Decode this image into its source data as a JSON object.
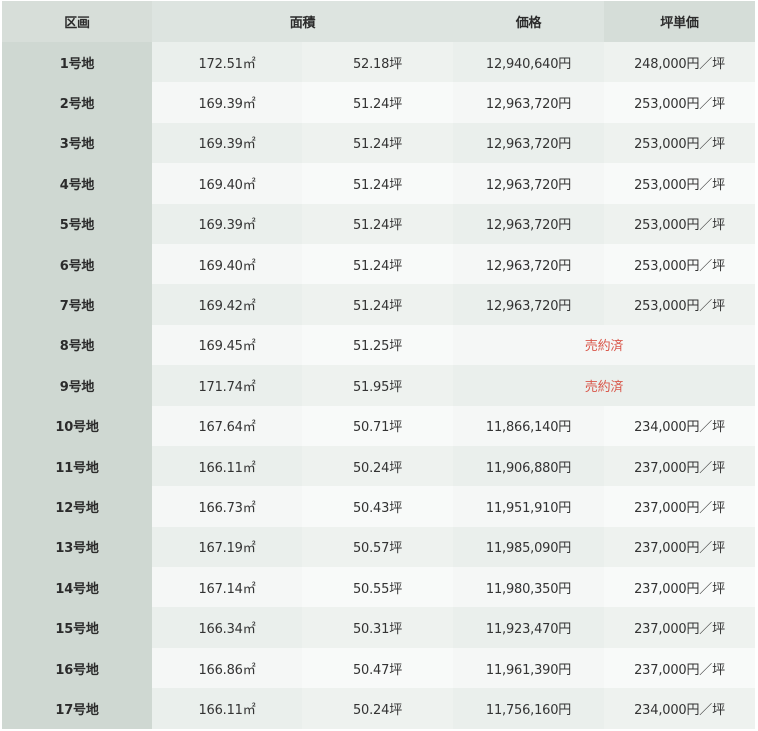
{
  "header": {
    "section": "区画",
    "area": "面積",
    "price": "価格",
    "unit_price": "坪単価"
  },
  "sold_label": "売約済",
  "rows": [
    {
      "section": "1号地",
      "m2": "172.51㎡",
      "tsubo": "52.18坪",
      "price": "12,940,640円",
      "unit": "248,000円／坪",
      "sold": false
    },
    {
      "section": "2号地",
      "m2": "169.39㎡",
      "tsubo": "51.24坪",
      "price": "12,963,720円",
      "unit": "253,000円／坪",
      "sold": false
    },
    {
      "section": "3号地",
      "m2": "169.39㎡",
      "tsubo": "51.24坪",
      "price": "12,963,720円",
      "unit": "253,000円／坪",
      "sold": false
    },
    {
      "section": "4号地",
      "m2": "169.40㎡",
      "tsubo": "51.24坪",
      "price": "12,963,720円",
      "unit": "253,000円／坪",
      "sold": false
    },
    {
      "section": "5号地",
      "m2": "169.39㎡",
      "tsubo": "51.24坪",
      "price": "12,963,720円",
      "unit": "253,000円／坪",
      "sold": false
    },
    {
      "section": "6号地",
      "m2": "169.40㎡",
      "tsubo": "51.24坪",
      "price": "12,963,720円",
      "unit": "253,000円／坪",
      "sold": false
    },
    {
      "section": "7号地",
      "m2": "169.42㎡",
      "tsubo": "51.24坪",
      "price": "12,963,720円",
      "unit": "253,000円／坪",
      "sold": false
    },
    {
      "section": "8号地",
      "m2": "169.45㎡",
      "tsubo": "51.25坪",
      "price": "",
      "unit": "",
      "sold": true
    },
    {
      "section": "9号地",
      "m2": "171.74㎡",
      "tsubo": "51.95坪",
      "price": "",
      "unit": "",
      "sold": true
    },
    {
      "section": "10号地",
      "m2": "167.64㎡",
      "tsubo": "50.71坪",
      "price": "11,866,140円",
      "unit": "234,000円／坪",
      "sold": false
    },
    {
      "section": "11号地",
      "m2": "166.11㎡",
      "tsubo": "50.24坪",
      "price": "11,906,880円",
      "unit": "237,000円／坪",
      "sold": false
    },
    {
      "section": "12号地",
      "m2": "166.73㎡",
      "tsubo": "50.43坪",
      "price": "11,951,910円",
      "unit": "237,000円／坪",
      "sold": false
    },
    {
      "section": "13号地",
      "m2": "167.19㎡",
      "tsubo": "50.57坪",
      "price": "11,985,090円",
      "unit": "237,000円／坪",
      "sold": false
    },
    {
      "section": "14号地",
      "m2": "167.14㎡",
      "tsubo": "50.55坪",
      "price": "11,980,350円",
      "unit": "237,000円／坪",
      "sold": false
    },
    {
      "section": "15号地",
      "m2": "166.34㎡",
      "tsubo": "50.31坪",
      "price": "11,923,470円",
      "unit": "237,000円／坪",
      "sold": false
    },
    {
      "section": "16号地",
      "m2": "166.86㎡",
      "tsubo": "50.47坪",
      "price": "11,961,390円",
      "unit": "237,000円／坪",
      "sold": false
    },
    {
      "section": "17号地",
      "m2": "166.11㎡",
      "tsubo": "50.24坪",
      "price": "11,756,160円",
      "unit": "234,000円／坪",
      "sold": false
    }
  ]
}
